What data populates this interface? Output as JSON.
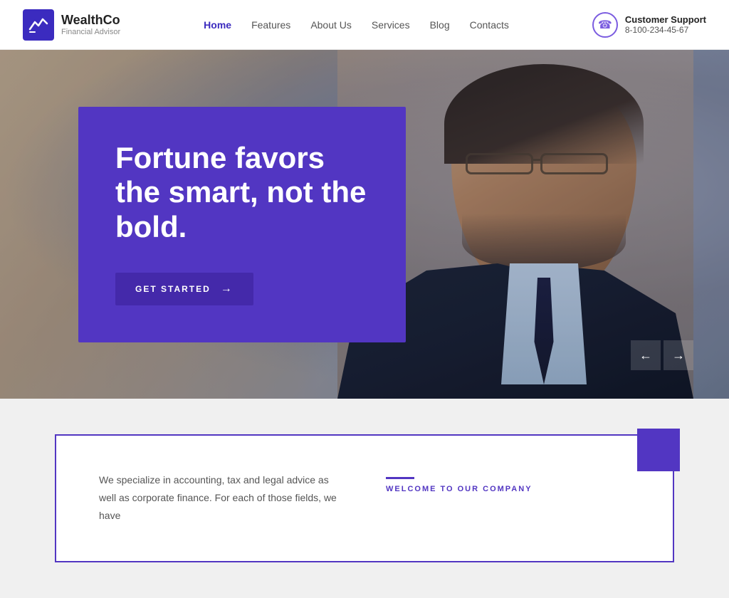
{
  "brand": {
    "name": "WealthCo",
    "tagline": "Financial Advisor"
  },
  "nav": {
    "items": [
      {
        "label": "Home",
        "active": true
      },
      {
        "label": "Features",
        "active": false
      },
      {
        "label": "About Us",
        "active": false
      },
      {
        "label": "Services",
        "active": false
      },
      {
        "label": "Blog",
        "active": false
      },
      {
        "label": "Contacts",
        "active": false
      }
    ]
  },
  "support": {
    "label": "Customer Support",
    "phone": "8-100-234-45-67"
  },
  "hero": {
    "title": "Fortune favors the smart, not the bold.",
    "cta_label": "GET STARTED",
    "slider_prev": "←",
    "slider_next": "→"
  },
  "section": {
    "description": "We specialize in accounting, tax and legal advice as well as corporate finance. For each of those fields, we have",
    "welcome_label": "WELCOME TO OUR COMPANY"
  },
  "colors": {
    "primary": "#5236c2",
    "primary_dark": "#4429aa",
    "white": "#ffffff"
  },
  "icons": {
    "phone": "☎",
    "arrow_right": "→",
    "arrow_left": "←"
  }
}
